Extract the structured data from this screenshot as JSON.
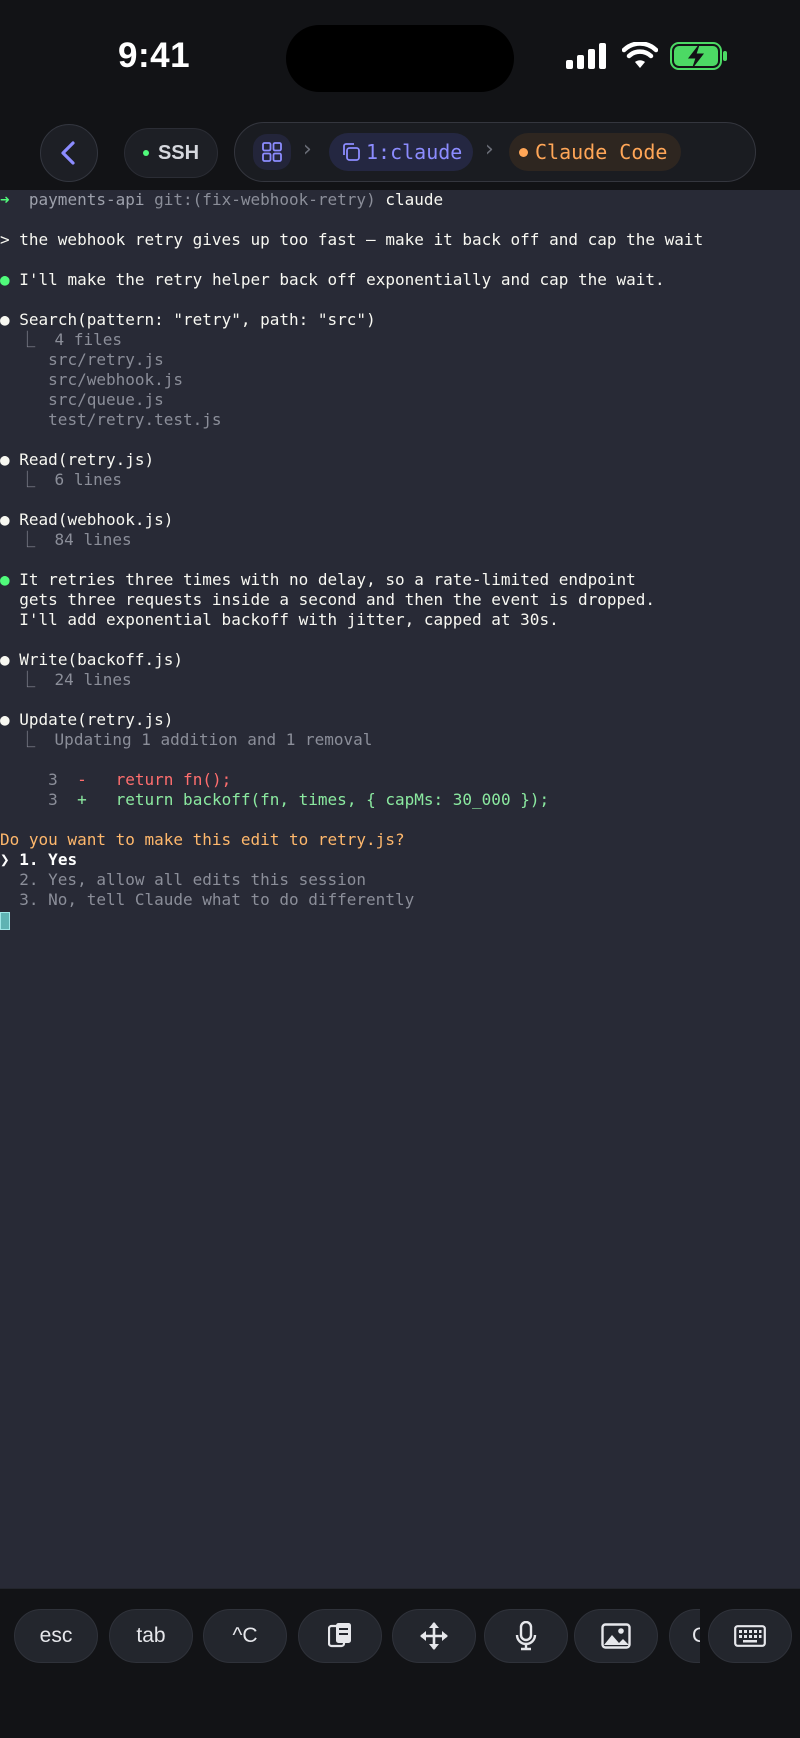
{
  "status_bar": {
    "time": "9:41",
    "signal_icon": "signal-bars-icon",
    "wifi_icon": "wifi-icon",
    "battery_icon": "battery-charging-icon"
  },
  "nav": {
    "back_icon": "chevron-left-icon",
    "ssh_label": "SSH",
    "session_label": "1:claude",
    "app_label": "Claude Code",
    "accent": "#8c8cff",
    "app_accent": "#ffa657"
  },
  "terminal": {
    "prompt": {
      "arrow": "➜",
      "dir": "payments-api",
      "git": "git:(fix-webhook-retry)",
      "command": "claude"
    },
    "user_message": "> the webhook retry gives up too fast — make it back off and cap the wait",
    "assistant_intro": "I'll make the retry helper back off exponentially and cap the wait.",
    "search": {
      "call": "Search(pattern: \"retry\", path: \"src\")",
      "summary": "4 files",
      "files": [
        "src/retry.js",
        "src/webhook.js",
        "src/queue.js",
        "test/retry.test.js"
      ]
    },
    "read1": {
      "call": "Read(retry.js)",
      "summary": "6 lines"
    },
    "read2": {
      "call": "Read(webhook.js)",
      "summary": "84 lines"
    },
    "explanation": [
      "It retries three times with no delay, so a rate-limited endpoint",
      "gets three requests inside a second and then the event is dropped.",
      "I'll add exponential backoff with jitter, capped at 30s."
    ],
    "write": {
      "call": "Write(backoff.js)",
      "summary": "24 lines"
    },
    "update": {
      "call": "Update(retry.js)",
      "summary": "Updating 1 addition and 1 removal",
      "removed": {
        "line_no": "3",
        "sign": "-",
        "code": "return fn();"
      },
      "added": {
        "line_no": "3",
        "sign": "+",
        "code": "return backoff(fn, times, { capMs: 30_000 });"
      }
    },
    "question": "Do you want to make this edit to retry.js?",
    "options": [
      {
        "marker": "❯",
        "label": "1. Yes"
      },
      {
        "marker": "",
        "label": "2. Yes, allow all edits this session"
      },
      {
        "marker": "",
        "label": "3. No, tell Claude what to do differently"
      }
    ]
  },
  "keybar": {
    "keys": [
      {
        "label": "esc"
      },
      {
        "label": "tab"
      },
      {
        "label": "^C"
      },
      {
        "icon": "paste-icon"
      },
      {
        "icon": "move-arrows-icon"
      },
      {
        "icon": "microphone-icon"
      },
      {
        "icon": "image-icon"
      },
      {
        "label": "C"
      },
      {
        "icon": "keyboard-icon"
      }
    ]
  }
}
